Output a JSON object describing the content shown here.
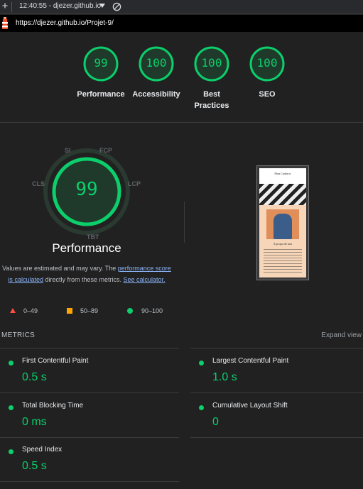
{
  "browser": {
    "new_tab_symbol": "+",
    "context": "12:40:55 - djezer.github.io",
    "url": "https://djezer.github.io/Projet-9/"
  },
  "categories": [
    {
      "label": "Performance",
      "score": "99"
    },
    {
      "label": "Accessibility",
      "score": "100"
    },
    {
      "label": "Best Practices",
      "score": "100"
    },
    {
      "label": "SEO",
      "score": "100"
    }
  ],
  "perf": {
    "score": "99",
    "title": "Performance",
    "gauge_labels": {
      "si": "SI",
      "fcp": "FCP",
      "lcp": "LCP",
      "tbt": "TBT",
      "cls": "CLS"
    },
    "note_pre": "Values are estimated and may vary. The ",
    "note_link1": "performance score is calculated",
    "note_mid": " directly from these metrics. ",
    "note_link2": "See calculator."
  },
  "thumbnail": {
    "site_name": "Nina Carducci",
    "section_title": "A propos de moi"
  },
  "legend": {
    "fail": "0–49",
    "average": "50–89",
    "pass": "90–100"
  },
  "metrics": {
    "header": "METRICS",
    "expand": "Expand view",
    "items": [
      {
        "name": "First Contentful Paint",
        "value": "0.5 s"
      },
      {
        "name": "Largest Contentful Paint",
        "value": "1.0 s"
      },
      {
        "name": "Total Blocking Time",
        "value": "0 ms"
      },
      {
        "name": "Cumulative Layout Shift",
        "value": "0"
      },
      {
        "name": "Speed Index",
        "value": "0.5 s"
      }
    ]
  },
  "colors": {
    "pass": "#0cce6b",
    "average": "#ffa400",
    "fail": "#ff4e42",
    "link": "#8ab4f8"
  }
}
